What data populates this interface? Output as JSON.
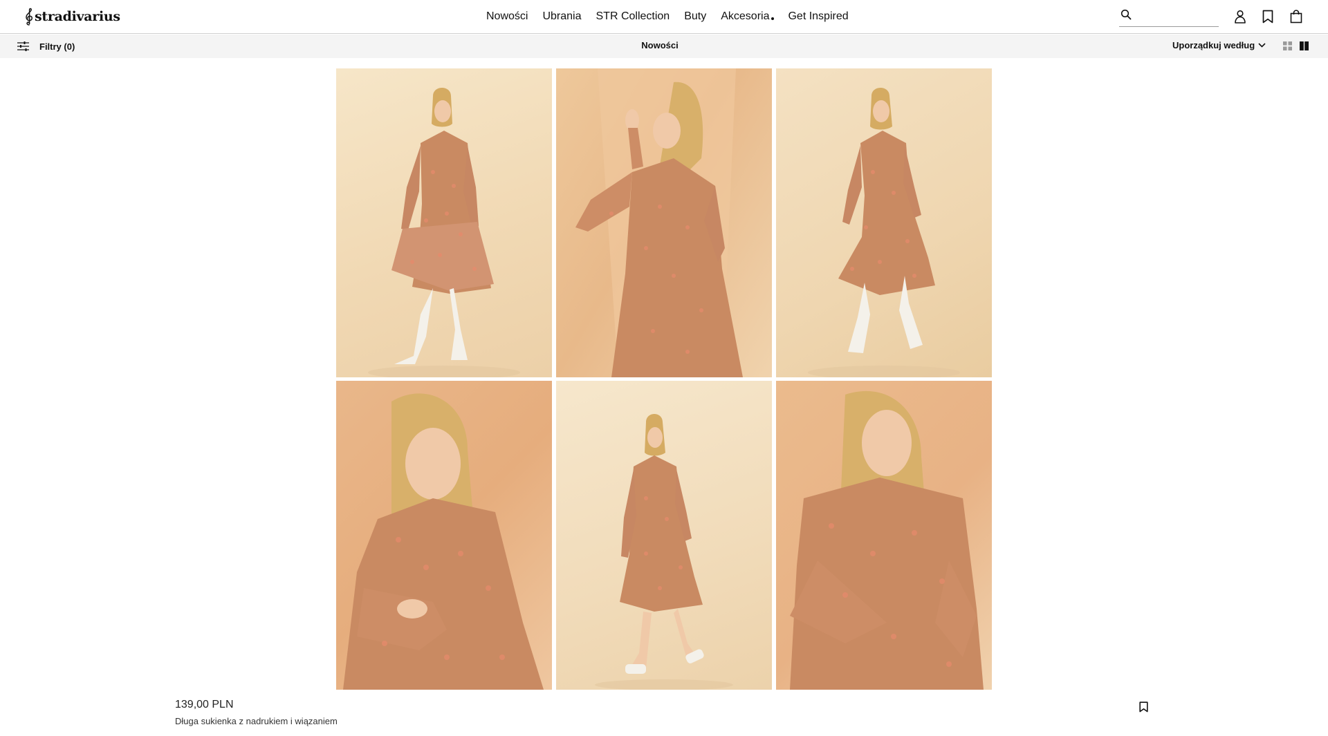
{
  "brand": {
    "name": "stradivarius",
    "logo_icon": "treble-clef-icon"
  },
  "nav": {
    "items": [
      {
        "label": "Nowości"
      },
      {
        "label": "Ubrania"
      },
      {
        "label": "STR Collection"
      },
      {
        "label": "Buty"
      },
      {
        "label": "Akcesoria"
      }
    ],
    "extra": {
      "label": "Get Inspired"
    }
  },
  "search": {
    "value": "",
    "placeholder": "",
    "icon": "search-icon"
  },
  "header_icons": [
    "user-icon",
    "bookmark-icon",
    "shopping-bag-icon"
  ],
  "subbar": {
    "filters_label": "Filtry (0)",
    "title": "Nowości",
    "sort_label": "Uporządkuj według",
    "view_modes": [
      "grid-4-icon",
      "grid-2-icon"
    ],
    "active_view": "grid-2"
  },
  "product": {
    "images": [
      "model-full-length-standing-white-boots",
      "model-three-quarter-hand-raised",
      "model-full-length-striding-white-boots",
      "model-seated-close-up",
      "model-full-length-walking-sneakers",
      "model-seated-close-up-looking-away"
    ],
    "price": "139,00 PLN",
    "name": "Długa sukienka z nadrukiem i wiązaniem"
  },
  "colors": {
    "dress": "#c98a62",
    "backdrop_light": "#f2dcb8",
    "backdrop_orange": "#e8b386",
    "hair": "#d8b06a",
    "skin": "#f0c9a8",
    "boots": "#f4f1ea"
  }
}
